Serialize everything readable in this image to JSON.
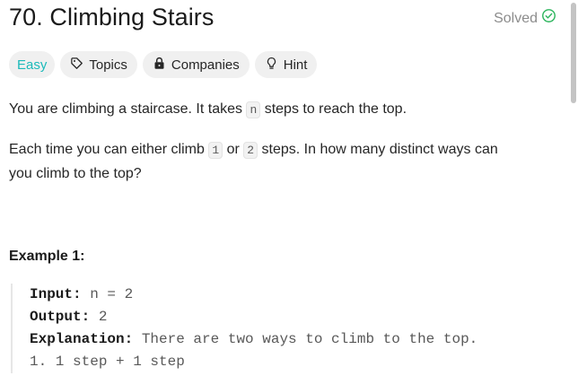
{
  "problem": {
    "title": "70. Climbing Stairs",
    "status": "Solved"
  },
  "tags": [
    {
      "label": "Easy",
      "icon": ""
    },
    {
      "label": "Topics",
      "icon": "tag-icon"
    },
    {
      "label": "Companies",
      "icon": "lock-icon"
    },
    {
      "label": "Hint",
      "icon": "lightbulb-icon"
    }
  ],
  "description": {
    "p1_a": "You are climbing a staircase. It takes ",
    "p1_code": "n",
    "p1_b": " steps to reach the top.",
    "p2_a": "Each time you can either climb ",
    "p2_code1": "1",
    "p2_b": " or ",
    "p2_code2": "2",
    "p2_c": " steps. In how many distinct ways can",
    "p2_d": "you climb to the top?"
  },
  "example1": {
    "title": "Example 1:",
    "input_label": "Input:",
    "input_value": " n = 2",
    "output_label": "Output:",
    "output_value": " 2",
    "explanation_label": "Explanation:",
    "explanation_value": " There are two ways to climb to the top.",
    "step1": "1. 1 step + 1 step"
  },
  "colors": {
    "easy": "#1cbaba",
    "solved_check": "#2db55d",
    "tag_bg": "#f0f0f0"
  }
}
